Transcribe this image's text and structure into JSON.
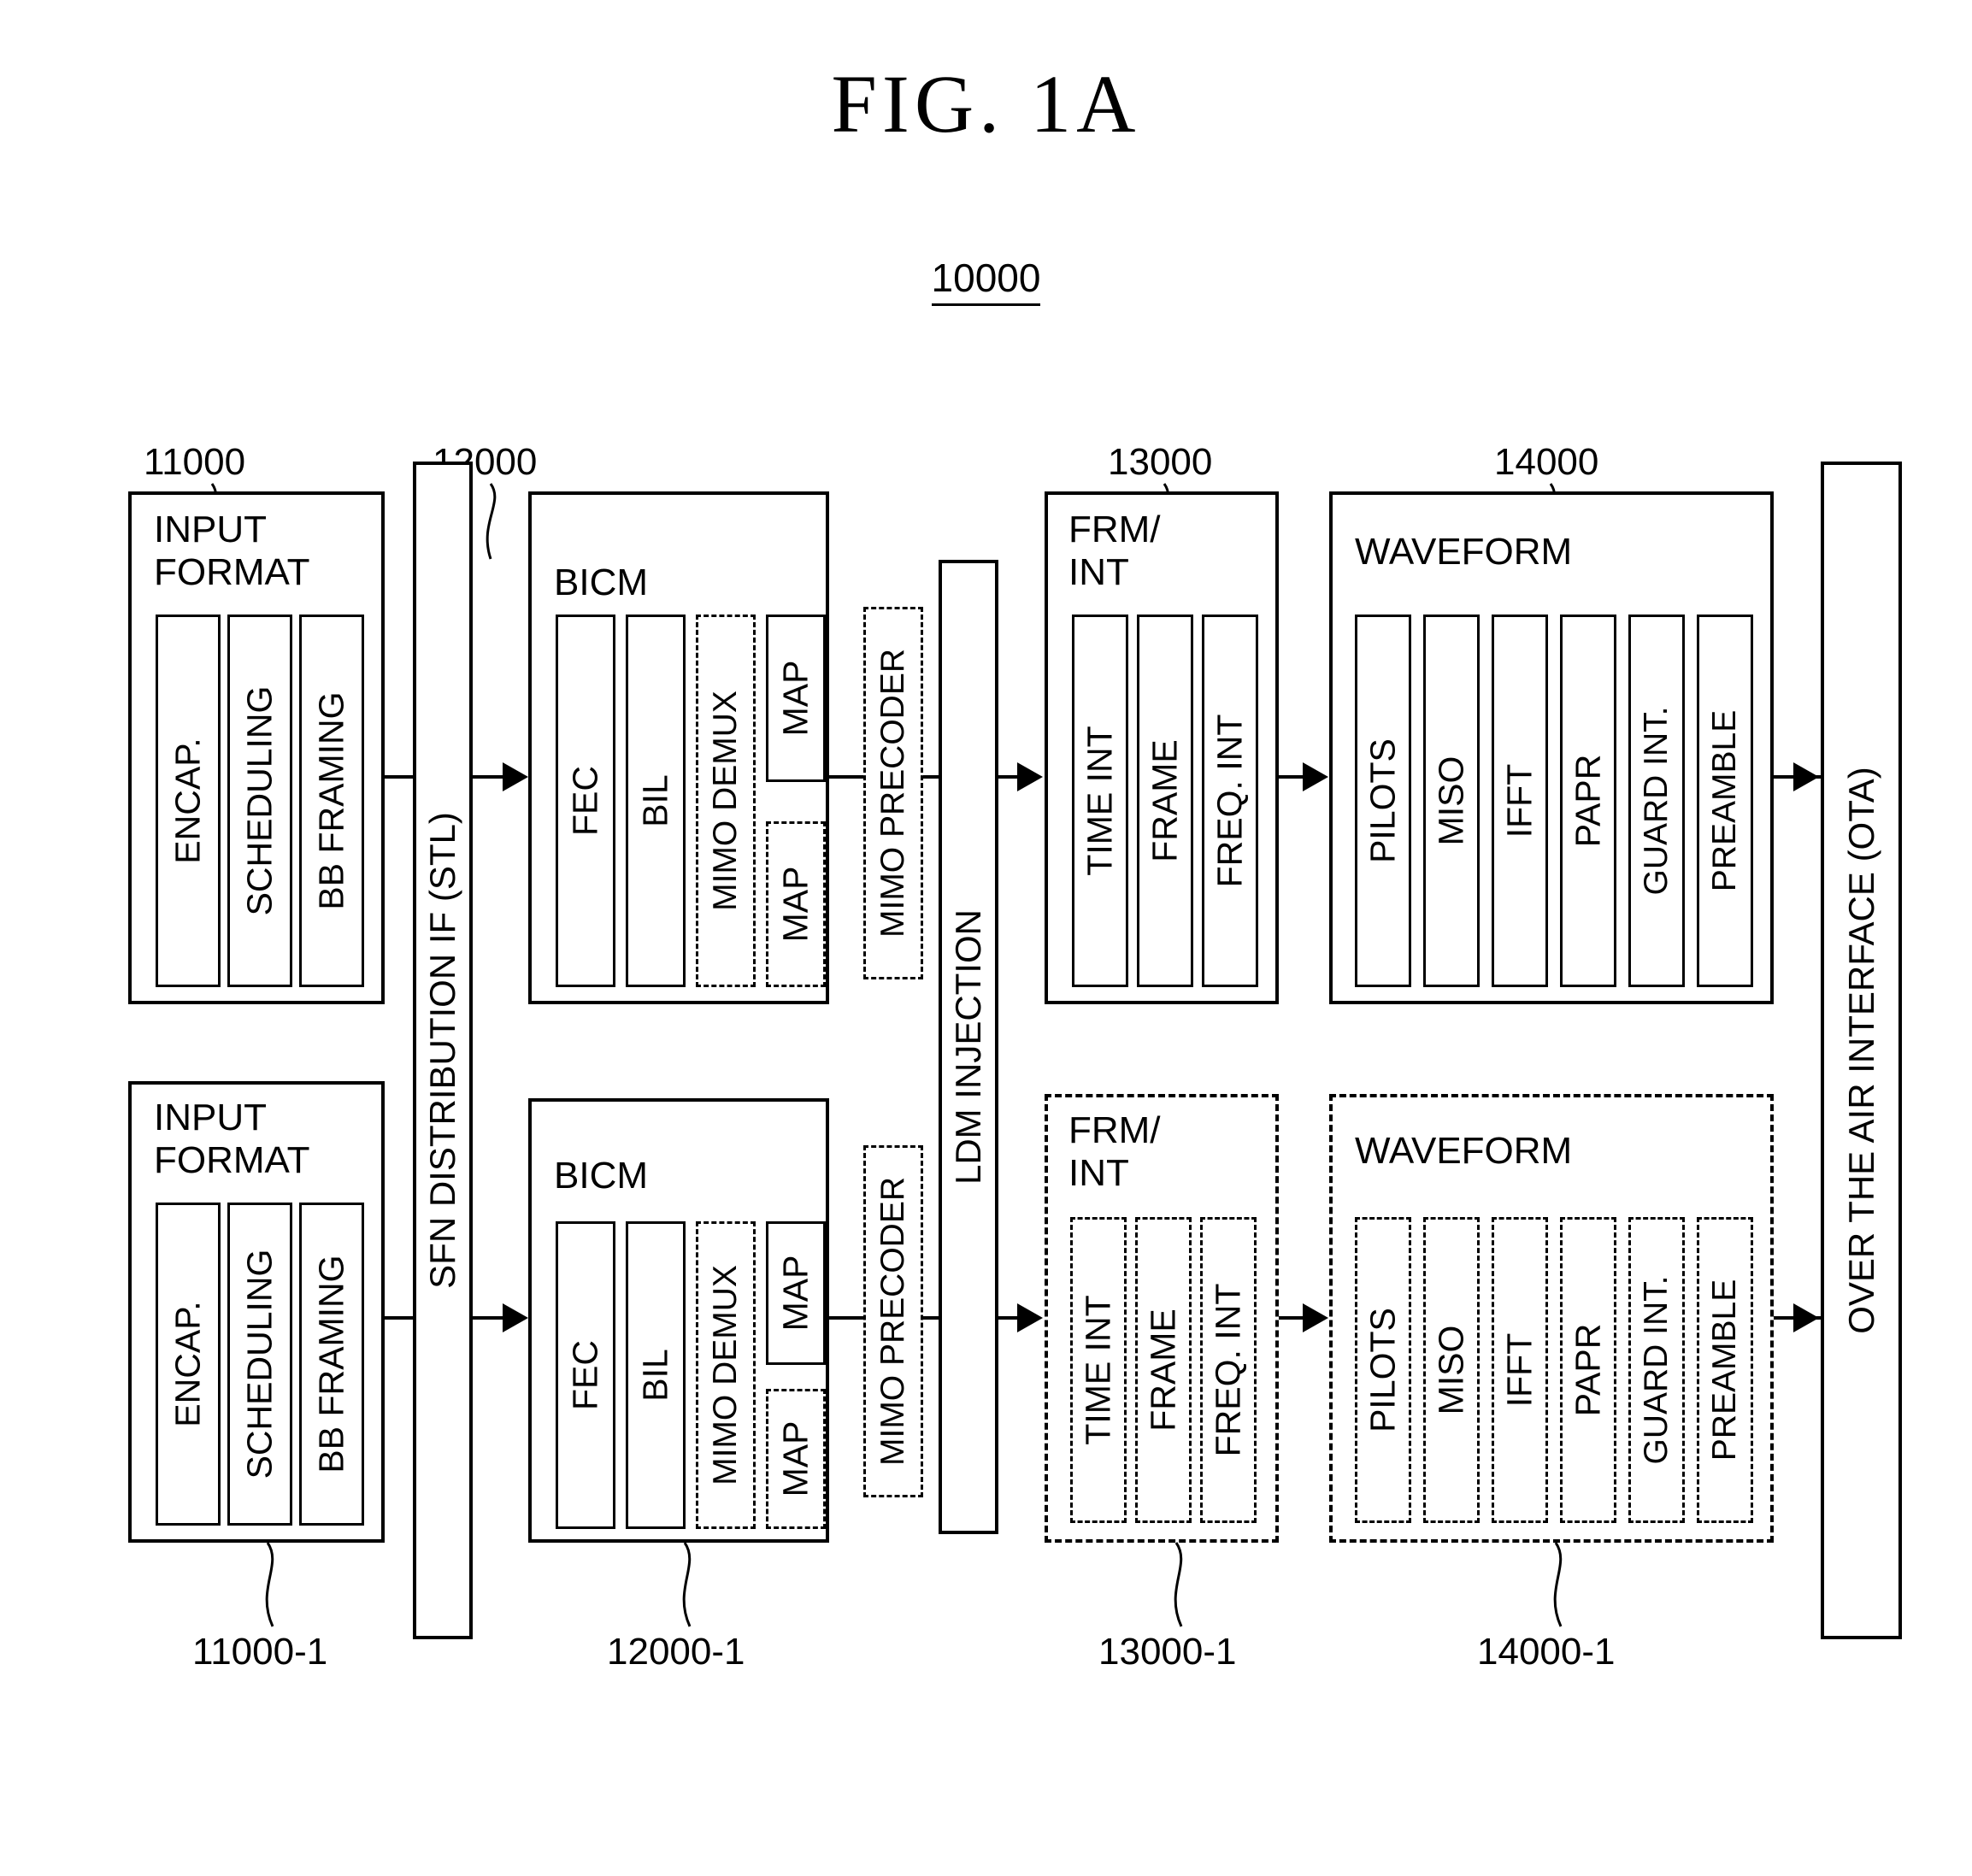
{
  "figure": {
    "title": "FIG.  1A",
    "system_number": "10000"
  },
  "reference_numerals": {
    "top": [
      "11000",
      "12000",
      "13000",
      "14000"
    ],
    "bottom": [
      "11000-1",
      "12000-1",
      "13000-1",
      "14000-1"
    ]
  },
  "side_bars": {
    "sfn": "SFN DISTRIBUTION IF (STL)",
    "ldm": "LDM INJECTION",
    "ota": "OVER THE AIR INTERFACE (OTA)"
  },
  "top_chain": {
    "input_format": {
      "label": "INPUT\nFORMAT",
      "blocks": [
        "ENCAP.",
        "SCHEDULING",
        "BB FRAMING"
      ]
    },
    "bicm": {
      "label": "BICM",
      "blocks": [
        "FEC",
        "BIL",
        "MIMO DEMUX"
      ],
      "map_solid": "MAP",
      "map_dashed": "MAP"
    },
    "mimo_precoder": "MIMO PRECODER",
    "frm_int": {
      "label": "FRM/\nINT",
      "blocks": [
        "TIME INT",
        "FRAME",
        "FREQ. INT"
      ]
    },
    "waveform": {
      "label": "WAVEFORM",
      "blocks": [
        "PILOTS",
        "MISO",
        "IFFT",
        "PAPR",
        "GUARD INT.",
        "PREAMBLE"
      ]
    }
  },
  "bottom_chain": {
    "input_format": {
      "label": "INPUT\nFORMAT",
      "blocks": [
        "ENCAP.",
        "SCHEDULING",
        "BB FRAMING"
      ]
    },
    "bicm": {
      "label": "BICM",
      "blocks": [
        "FEC",
        "BIL",
        "MIMO DEMUX"
      ],
      "map_solid": "MAP",
      "map_dashed": "MAP"
    },
    "mimo_precoder": "MIMO PRECODER",
    "frm_int": {
      "label": "FRM/\nINT",
      "blocks": [
        "TIME INT",
        "FRAME",
        "FREQ. INT"
      ]
    },
    "waveform": {
      "label": "WAVEFORM",
      "blocks": [
        "PILOTS",
        "MISO",
        "IFFT",
        "PAPR",
        "GUARD INT.",
        "PREAMBLE"
      ]
    }
  }
}
